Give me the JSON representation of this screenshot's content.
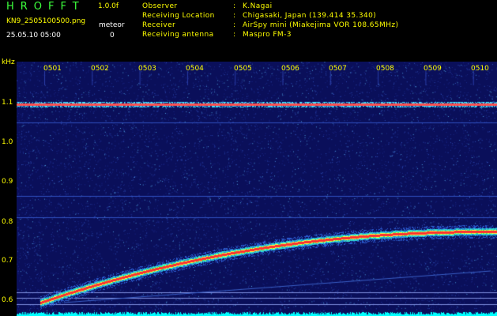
{
  "header": {
    "app_title": "HROFFT",
    "version": "1.0.0f",
    "filename": "KN9_2505100500.png",
    "meteor_label": "meteor",
    "meteor_count": "0",
    "timestamp": "25.05.10 05:00"
  },
  "metadata": [
    {
      "label": "Observer",
      "value": "K.Nagai"
    },
    {
      "label": "Receiving Location",
      "value": "Chigasaki, Japan (139.414 35.340)"
    },
    {
      "label": "Receiver",
      "value": "AirSpy mini (Miakejima VOR 108.65MHz)"
    },
    {
      "label": "Receiving antenna",
      "value": "Maspro FM-3"
    }
  ],
  "separator": ":",
  "spectrogram": {
    "y_unit": "kHz",
    "y_ticks": [
      "1.1",
      "1.0",
      "0.9",
      "0.8",
      "0.7",
      "0.6"
    ],
    "x_ticks": [
      "0501",
      "0502",
      "0503",
      "0504",
      "0505",
      "0506",
      "0507",
      "0508",
      "0509",
      "0510"
    ],
    "background_color": "#0a0f5a",
    "carrier_color": "#ff5050",
    "trace_color": "#ff3030",
    "noise_color": "#00ffff"
  }
}
